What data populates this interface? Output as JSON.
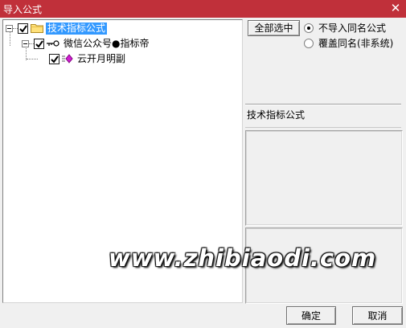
{
  "window": {
    "title": "导入公式",
    "close_glyph": "✕"
  },
  "tree": {
    "root": {
      "label": "技术指标公式",
      "checked": true
    },
    "child": {
      "label": "微信公众号●指标帝",
      "checked": true
    },
    "leaf": {
      "label": "云开月明副",
      "checked": true
    }
  },
  "options": {
    "select_all_label": "全部选中",
    "radio_options": [
      {
        "label": "不导入同名公式",
        "checked": true
      },
      {
        "label": "覆盖同名(非系统)",
        "checked": false
      }
    ]
  },
  "info": {
    "category_label": "技术指标公式"
  },
  "watermark": "www.zhibiaodi.com",
  "buttons": {
    "ok_label": "确定",
    "cancel_label": "取消"
  },
  "colors": {
    "titlebar": "#c0303a",
    "selection": "#3399ff"
  }
}
